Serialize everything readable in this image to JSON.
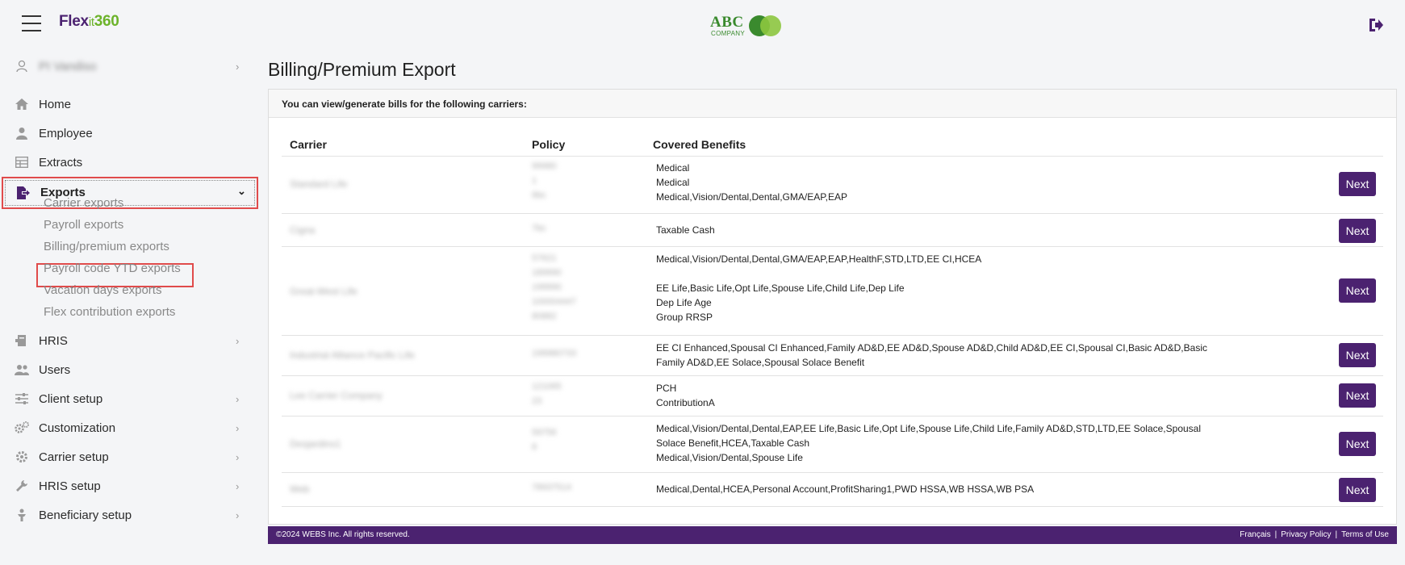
{
  "brand": {
    "part1": "Flex",
    "part2": "it",
    "part3": "360"
  },
  "company_logo": {
    "text": "ABC",
    "sub": "COMPANY"
  },
  "sidebar": {
    "user_name": "PI Vandiso",
    "items": [
      {
        "label": "Home",
        "icon": "home-icon"
      },
      {
        "label": "Employee",
        "icon": "person-icon"
      },
      {
        "label": "Extracts",
        "icon": "table-icon"
      },
      {
        "label": "Exports",
        "icon": "export-file-icon"
      },
      {
        "label": "HRIS",
        "icon": "hris-icon"
      },
      {
        "label": "Users",
        "icon": "users-icon"
      },
      {
        "label": "Client setup",
        "icon": "sliders-icon"
      },
      {
        "label": "Customization",
        "icon": "gears-icon"
      },
      {
        "label": "Carrier setup",
        "icon": "gear-icon"
      },
      {
        "label": "HRIS setup",
        "icon": "wrench-icon"
      },
      {
        "label": "Beneficiary setup",
        "icon": "beneficiary-icon"
      }
    ],
    "exports_sub": [
      "Carrier exports",
      "Payroll exports",
      "Billing/premium exports",
      "Payroll code YTD exports",
      "Vacation days exports",
      "Flex contribution exports"
    ]
  },
  "page": {
    "title": "Billing/Premium Export",
    "panel_heading": "You can view/generate bills for the following carriers:",
    "columns": {
      "carrier": "Carrier",
      "policy": "Policy",
      "benefits": "Covered Benefits"
    },
    "next_label": "Next",
    "rows": [
      {
        "carrier": "Standard Life",
        "policies": [
          "99980",
          "1",
          "6bc"
        ],
        "benefits": [
          "Medical",
          "Medical",
          "Medical,Vision/Dental,Dental,GMA/EAP,EAP"
        ]
      },
      {
        "carrier": "Cigna",
        "policies": [
          "7bc"
        ],
        "benefits": [
          "Taxable Cash"
        ]
      },
      {
        "carrier": "Great-West Life",
        "policies": [
          "57621",
          "189990",
          "199990",
          "100004447",
          "80882"
        ],
        "benefits": [
          "Medical,Vision/Dental,Dental,GMA/EAP,EAP,HealthF,STD,LTD,EE CI,HCEA",
          "",
          "EE Life,Basic Life,Opt Life,Spouse Life,Child Life,Dep Life",
          "Dep Life Age",
          "Group RRSP"
        ]
      },
      {
        "carrier": "Industrial Alliance Pacific Life",
        "policies": [
          "199980733"
        ],
        "benefits": [
          "EE CI Enhanced,Spousal CI Enhanced,Family AD&D,EE AD&D,Spouse AD&D,Child AD&D,EE CI,Spousal CI,Basic AD&D,Basic",
          "Family AD&D,EE Solace,Spousal Solace Benefit"
        ]
      },
      {
        "carrier": "Lee Carrier Company",
        "policies": [
          "121065",
          "23"
        ],
        "benefits": [
          "PCH",
          "ContributionA"
        ]
      },
      {
        "carrier": "Desjardins1",
        "policies": [
          "59756",
          "8"
        ],
        "benefits": [
          "Medical,Vision/Dental,Dental,EAP,EE Life,Basic Life,Opt Life,Spouse Life,Child Life,Family AD&D,STD,LTD,EE Solace,Spousal",
          "Solace Benefit,HCEA,Taxable Cash",
          "Medical,Vision/Dental,Spouse Life"
        ]
      },
      {
        "carrier": "Web",
        "policies": [
          "78937514"
        ],
        "benefits": [
          "Medical,Dental,HCEA,Personal Account,ProfitSharing1,PWD HSSA,WB HSSA,WB PSA"
        ]
      }
    ]
  },
  "footer": {
    "copyright": "©2024 WEBS Inc. All rights reserved.",
    "links": [
      "Français",
      "Privacy Policy",
      "Terms of Use"
    ]
  },
  "colors": {
    "brand_purple": "#4b2270",
    "brand_green": "#6cb32a",
    "highlight_red": "#e04b4b"
  }
}
